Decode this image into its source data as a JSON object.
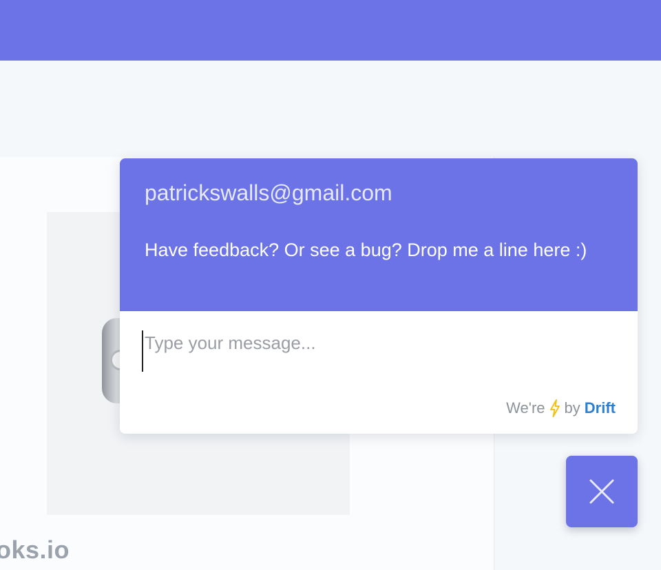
{
  "background": {
    "caption": "oks.io"
  },
  "chat": {
    "email": "patrickswalls@gmail.com",
    "welcome": "Have feedback? Or see a bug? Drop me a line here :)",
    "input_placeholder": "Type your message...",
    "powered_prefix": "We're",
    "powered_icon": "lightning-bolt-icon",
    "powered_by": "by",
    "brand": "Drift",
    "accent_color": "#6b73e6",
    "brand_color": "#2a7fd4"
  },
  "close_button": {
    "icon": "close-icon"
  }
}
